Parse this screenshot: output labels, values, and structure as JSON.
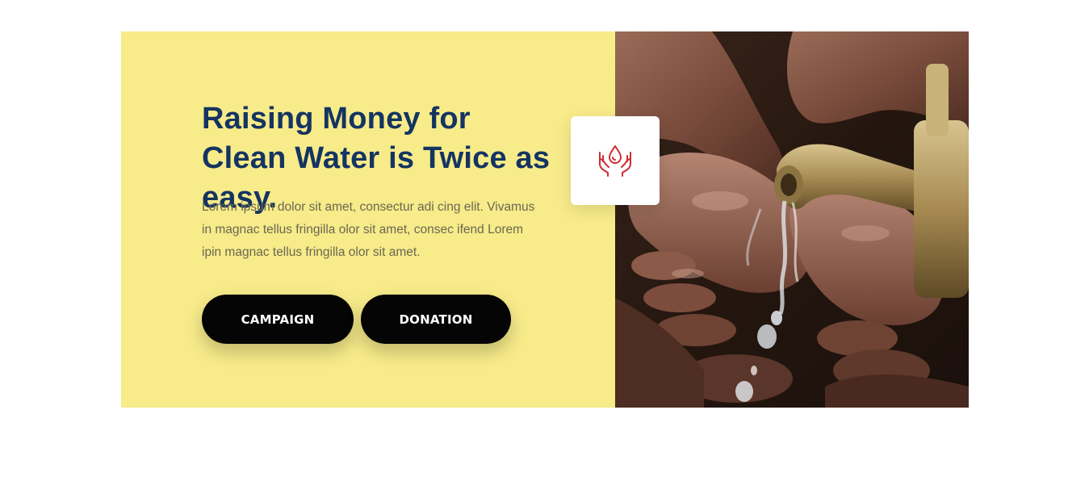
{
  "hero": {
    "headline": "Raising Money for Clean Water is Twice as easy.",
    "body": "Lorem ipsum dolor sit amet, consectur adi cing elit. Vivamus in magnac tellus fringilla olor sit amet, consec ifend Lorem ipin magnac tellus fringilla olor sit amet.",
    "buttons": {
      "campaign_label": "CAMPAIGN",
      "donation_label": "DONATION"
    }
  },
  "icon_card": {
    "icon": "water-drop-hands-icon",
    "icon_color": "#d12d35"
  },
  "colors": {
    "panel_background": "#f7eb8a",
    "headline": "#143461",
    "button_background": "#050505",
    "button_text": "#ffffff"
  },
  "image": {
    "subject": "photo-hands-under-water-tap"
  }
}
